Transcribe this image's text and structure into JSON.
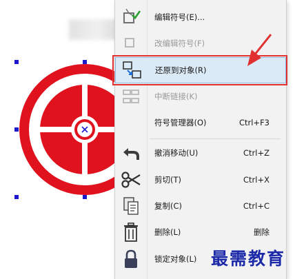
{
  "menu": {
    "items": [
      {
        "label": "编辑符号(E)...",
        "shortcut": "",
        "icon": "edit-symbol-icon",
        "disabled": false
      },
      {
        "label": "改编辑符号(F)",
        "shortcut": "",
        "icon": "",
        "disabled": true
      },
      {
        "label": "还原到对象(R)",
        "shortcut": "",
        "icon": "revert-to-object-icon",
        "disabled": false
      },
      {
        "label": "中断链接(K)",
        "shortcut": "",
        "icon": "break-link-icon",
        "disabled": true
      },
      {
        "label": "符号管理器(O)",
        "shortcut": "Ctrl+F3",
        "icon": "",
        "disabled": false
      },
      {
        "label": "撤消移动(U)",
        "shortcut": "Ctrl+Z",
        "icon": "undo-icon",
        "disabled": false
      },
      {
        "label": "剪切(T)",
        "shortcut": "Ctrl+X",
        "icon": "scissors-icon",
        "disabled": false
      },
      {
        "label": "复制(C)",
        "shortcut": "Ctrl+C",
        "icon": "copy-icon",
        "disabled": false
      },
      {
        "label": "删除(L)",
        "shortcut": "删除",
        "icon": "trash-icon",
        "disabled": false
      },
      {
        "label": "锁定对象(L)",
        "shortcut": "",
        "icon": "lock-icon",
        "disabled": false
      }
    ]
  },
  "watermark": "最需教育",
  "colors": {
    "target_red": "#e0121e",
    "handle_blue": "#1a1acc",
    "highlight_bg": "#dbeaf7",
    "highlight_border": "#8fb9e0",
    "callout_red": "#e03030"
  }
}
